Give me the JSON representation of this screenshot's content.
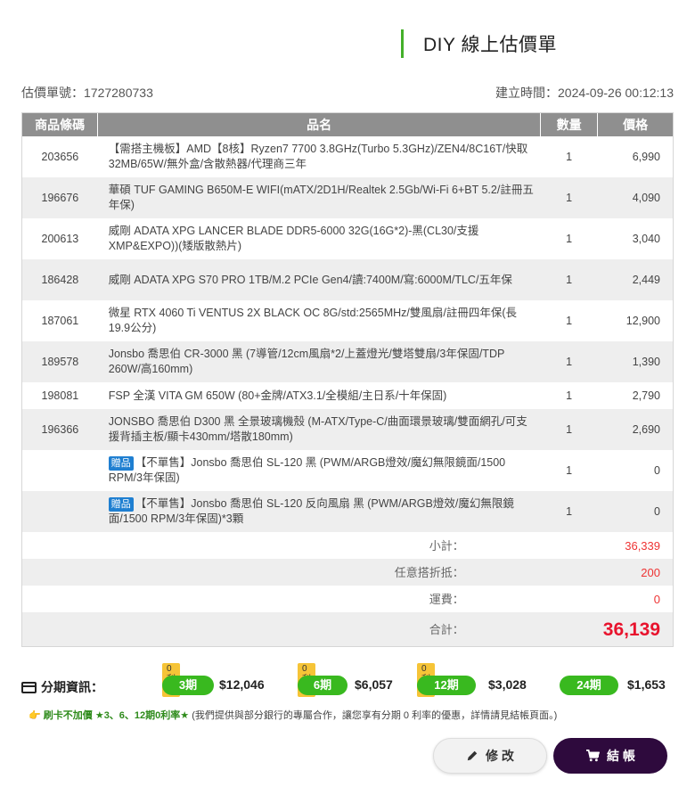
{
  "header": {
    "title": "DIY 線上估價單",
    "quote_no_label": "估價單號：",
    "quote_no": "1727280733",
    "created_label": "建立時間：",
    "created_at": "2024-09-26 00:12:13"
  },
  "table": {
    "headers": {
      "code": "商品條碼",
      "name": "品名",
      "qty": "數量",
      "price": "價格"
    },
    "rows": [
      {
        "code": "203656",
        "name": "【需搭主機板】AMD【8核】Ryzen7 7700 3.8GHz(Turbo 5.3GHz)/ZEN4/8C16T/快取32MB/65W/無外盒/含散熱器/代理商三年",
        "qty": "1",
        "price": "6,990"
      },
      {
        "code": "196676",
        "name": "華碩 TUF GAMING B650M-E WIFI(mATX/2D1H/Realtek 2.5Gb/Wi-Fi 6+BT 5.2/註冊五年保)",
        "qty": "1",
        "price": "4,090"
      },
      {
        "code": "200613",
        "name": "威剛 ADATA XPG LANCER BLADE DDR5-6000 32G(16G*2)-黑(CL30/支援XMP&EXPO))(矮版散熱片)",
        "qty": "1",
        "price": "3,040"
      },
      {
        "code": "186428",
        "name": "威剛 ADATA XPG S70 PRO 1TB/M.2 PCIe Gen4/讀:7400M/寫:6000M/TLC/五年保",
        "qty": "1",
        "price": "2,449"
      },
      {
        "code": "187061",
        "name": "微星 RTX 4060 Ti VENTUS 2X BLACK OC 8G/std:2565MHz/雙風扇/註冊四年保(長19.9公分)",
        "qty": "1",
        "price": "12,900"
      },
      {
        "code": "189578",
        "name": "Jonsbo 喬思伯 CR-3000 黑 (7導管/12cm風扇*2/上蓋燈光/雙塔雙扇/3年保固/TDP 260W/高160mm)",
        "qty": "1",
        "price": "1,390"
      },
      {
        "code": "198081",
        "name": "FSP 全漢 VITA GM 650W (80+金牌/ATX3.1/全模組/主日系/十年保固)",
        "qty": "1",
        "price": "2,790"
      },
      {
        "code": "196366",
        "name": "JONSBO 喬思伯 D300 黑 全景玻璃機殼 (M-ATX/Type-C/曲面環景玻璃/雙面網孔/可支援背插主板/顯卡430mm/塔散180mm)",
        "qty": "1",
        "price": "2,690"
      }
    ],
    "gifts": [
      {
        "tag": "贈品",
        "name": "【不單售】Jonsbo 喬思伯 SL-120 黑 (PWM/ARGB燈效/魔幻無限鏡面/1500 RPM/3年保固)",
        "qty": "1",
        "price": "0"
      },
      {
        "tag": "贈品",
        "name": "【不單售】Jonsbo 喬思伯 SL-120 反向風扇 黑 (PWM/ARGB燈效/魔幻無限鏡面/1500 RPM/3年保固)*3顆",
        "qty": "1",
        "price": "0"
      }
    ],
    "summary": {
      "subtotal_label": "小計：",
      "subtotal": "36,339",
      "discount_label": "任意搭折抵：",
      "discount": "200",
      "shipping_label": "運費：",
      "shipping": "0",
      "total_label": "合計：",
      "total": "36,139"
    }
  },
  "installment": {
    "label": "分期資訊：",
    "plans": [
      {
        "badge": "0利率",
        "term": "3期",
        "amount": "$12,046"
      },
      {
        "badge": "0利率",
        "term": "6期",
        "amount": "$6,057"
      },
      {
        "badge": "0利率",
        "term": "12期",
        "amount": "$3,028"
      },
      {
        "badge": "",
        "term": "24期",
        "amount": "$1,653"
      }
    ],
    "note_prefix": "刷卡不加價",
    "note_highlight": "★3、6、12期0利率★",
    "note_text": "(我們提供與部分銀行的專屬合作，讓您享有分期 0 利率的優惠，詳情請見結帳頁面。)"
  },
  "actions": {
    "edit": "修 改",
    "checkout": "結 帳"
  },
  "colors": {
    "accent_green": "#39b91f",
    "price_red": "#e8132d",
    "checkout_bg": "#2e0a3d",
    "gift_blue": "#1f7fd1"
  }
}
